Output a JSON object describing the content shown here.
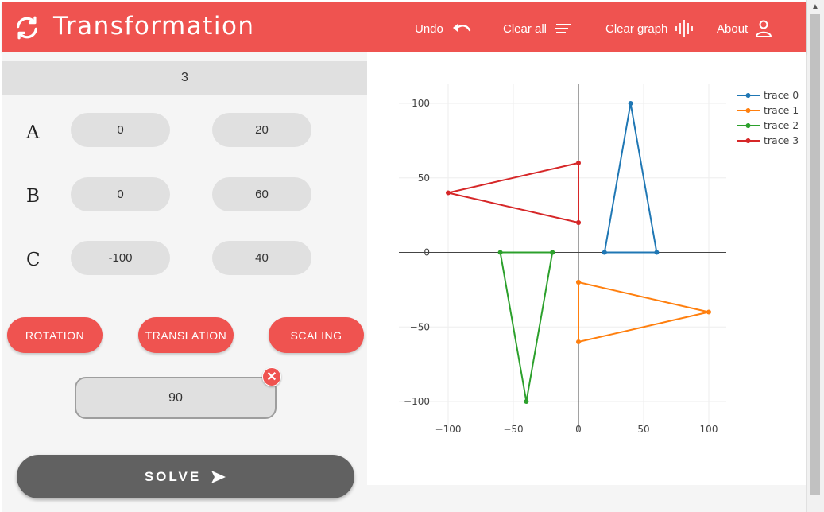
{
  "header": {
    "title": "Transformation",
    "undo_label": "Undo",
    "clear_all_label": "Clear all",
    "clear_graph_label": "Clear graph",
    "about_label": "About",
    "bg_color": "#ef5350"
  },
  "form": {
    "points_count": "3",
    "points": [
      {
        "label": "A",
        "x": "0",
        "y": "20"
      },
      {
        "label": "B",
        "x": "0",
        "y": "60"
      },
      {
        "label": "C",
        "x": "-100",
        "y": "40"
      }
    ],
    "operations": {
      "rotation": "ROTATION",
      "translation": "TRANSLATION",
      "scaling": "SCALING"
    },
    "parameter_value": "90",
    "clear_parameter": "✕",
    "solve_label": "SOLVE"
  },
  "chart_data": {
    "type": "line",
    "xlim": [
      -100,
      100
    ],
    "ylim": [
      -100,
      100
    ],
    "x_ticks": [
      -100,
      -50,
      0,
      50,
      100
    ],
    "y_ticks": [
      100,
      50,
      0,
      -50,
      -100
    ],
    "x_tick_labels": [
      "−100",
      "−50",
      "0",
      "50",
      "100"
    ],
    "y_tick_labels": [
      "100",
      "50",
      "0",
      "−50",
      "−100"
    ],
    "grid": true,
    "legend_position": "top-right",
    "series": [
      {
        "name": "trace 0",
        "color": "#1f77b4",
        "x": [
          20,
          40,
          60,
          20
        ],
        "y": [
          0,
          100,
          0,
          0
        ]
      },
      {
        "name": "trace 1",
        "color": "#ff7f0e",
        "x": [
          0,
          100,
          0,
          0
        ],
        "y": [
          -20,
          -40,
          -60,
          -20
        ]
      },
      {
        "name": "trace 2",
        "color": "#2ca02c",
        "x": [
          -20,
          -40,
          -60,
          -20
        ],
        "y": [
          0,
          -100,
          0,
          0
        ]
      },
      {
        "name": "trace 3",
        "color": "#d62728",
        "x": [
          0,
          0,
          -100,
          0
        ],
        "y": [
          20,
          60,
          40,
          20
        ]
      }
    ]
  }
}
